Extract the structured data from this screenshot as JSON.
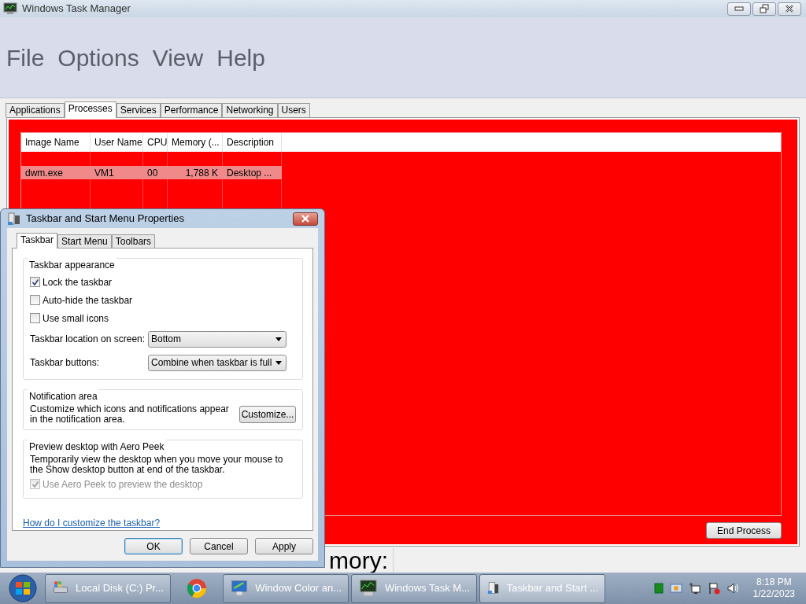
{
  "window": {
    "title": "Windows Task Manager"
  },
  "menu": [
    "File",
    "Options",
    "View",
    "Help"
  ],
  "tabs": [
    {
      "label": "Applications",
      "selected": false
    },
    {
      "label": "Processes",
      "selected": true
    },
    {
      "label": "Services",
      "selected": false
    },
    {
      "label": "Performance",
      "selected": false
    },
    {
      "label": "Networking",
      "selected": false
    },
    {
      "label": "Users",
      "selected": false
    }
  ],
  "process_table": {
    "columns": [
      "Image Name",
      "User Name",
      "CPU",
      "Memory (...",
      "Description"
    ],
    "rows": [
      {
        "cells": [
          "dwm.exe",
          "VM1",
          "00",
          "1,788 K",
          "Desktop ..."
        ],
        "selected": true
      }
    ]
  },
  "end_process_button": "End Process",
  "status_bar": {
    "text": "mory:"
  },
  "dialog": {
    "title": "Taskbar and Start Menu Properties",
    "tabs": [
      {
        "label": "Taskbar",
        "selected": true
      },
      {
        "label": "Start Menu",
        "selected": false
      },
      {
        "label": "Toolbars",
        "selected": false
      }
    ],
    "taskbar_appearance": {
      "heading": "Taskbar appearance",
      "checkboxes": [
        {
          "label": "Lock the taskbar",
          "checked": true
        },
        {
          "label": "Auto-hide the taskbar",
          "checked": false
        },
        {
          "label": "Use small icons",
          "checked": false
        }
      ],
      "dropdowns": [
        {
          "label": "Taskbar location on screen:",
          "value": "Bottom"
        },
        {
          "label": "Taskbar buttons:",
          "value": "Combine when taskbar is full"
        }
      ]
    },
    "notification_area": {
      "heading": "Notification area",
      "text": "Customize which icons and notifications appear in the notification area.",
      "button": "Customize..."
    },
    "aero_peek": {
      "heading": "Preview desktop with Aero Peek",
      "text": "Temporarily view the desktop when you move your mouse to the Show desktop button at end of the taskbar.",
      "checkbox": {
        "label": "Use Aero Peek to preview the desktop",
        "checked": true,
        "disabled": true
      }
    },
    "help_link": "How do I customize the taskbar?",
    "buttons": [
      {
        "label": "OK",
        "default": true
      },
      {
        "label": "Cancel",
        "default": false
      },
      {
        "label": "Apply",
        "default": false
      }
    ]
  },
  "taskbar": {
    "items": [
      {
        "kind": "start"
      },
      {
        "kind": "drive",
        "label": "Local Disk (C:) Pr...",
        "active": false
      },
      {
        "kind": "browser",
        "active": false
      },
      {
        "kind": "display",
        "label": "Window Color an...",
        "active": false
      },
      {
        "kind": "taskmgr",
        "label": "Windows Task M...",
        "active": false
      },
      {
        "kind": "props",
        "label": "Taskbar and Start ...",
        "active": true
      }
    ],
    "clock": {
      "time": "8:18 PM",
      "date": "1/22/2023"
    }
  }
}
